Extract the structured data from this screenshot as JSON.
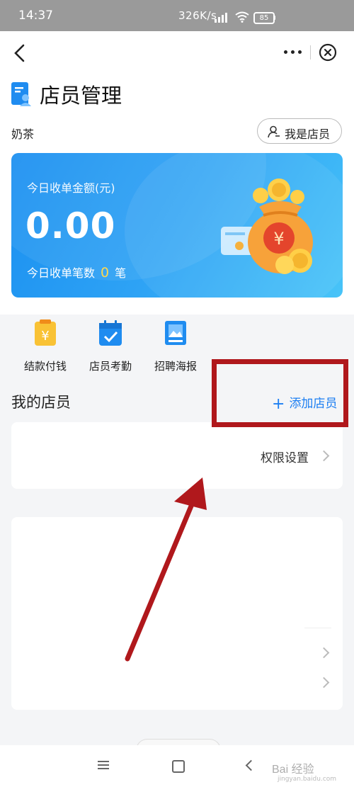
{
  "status_bar": {
    "time": "14:37",
    "network_speed": "326K/s",
    "battery": "85"
  },
  "header": {
    "title": "店员管理",
    "shop_name": "奶茶",
    "role_button": "我是店员"
  },
  "summary_card": {
    "amount_label": "今日收单金额(元)",
    "amount": "0.00",
    "count_prefix": "今日收单笔数",
    "count": "0",
    "count_suffix": "笔"
  },
  "actions": [
    {
      "label": "结款付钱",
      "icon": "wallet-yuan-icon"
    },
    {
      "label": "店员考勤",
      "icon": "calendar-check-icon"
    },
    {
      "label": "招聘海报",
      "icon": "poster-icon"
    }
  ],
  "staff_section": {
    "title": "我的店员",
    "add_label": "添加店员"
  },
  "permissions": {
    "label": "权限设置"
  },
  "watermark": {
    "text": "Bai 经验",
    "url": "jingyan.baidu.com"
  },
  "colors": {
    "accent": "#1b7ef2",
    "card_start": "#1a8ff0",
    "card_end": "#48c4f8",
    "annotation": "#b0181c",
    "count_highlight": "#ffd84d"
  }
}
